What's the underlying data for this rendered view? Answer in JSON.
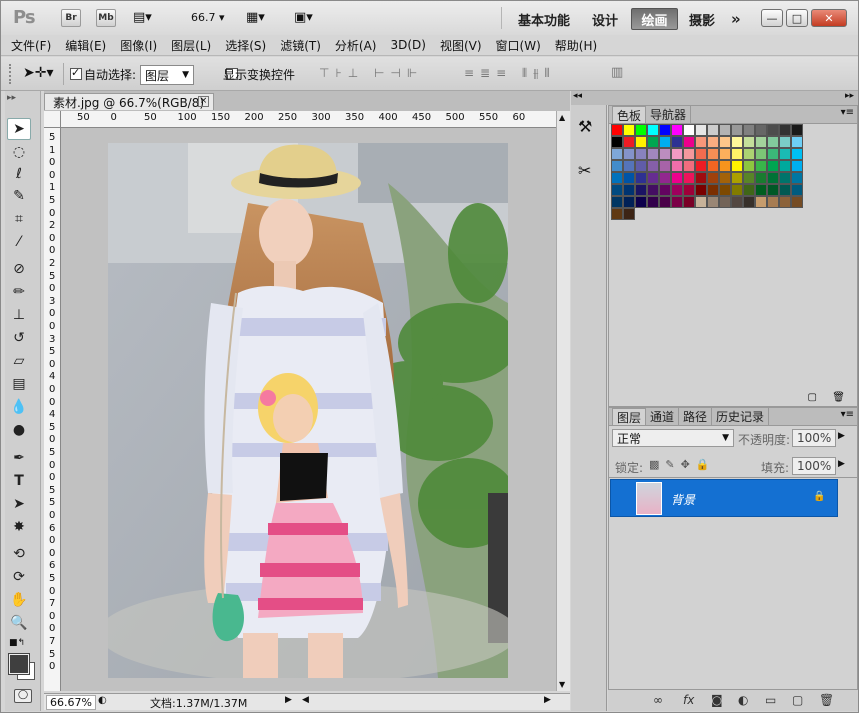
{
  "app": {
    "logo": "Ps",
    "bridge": "Br",
    "minibridge": "Mb",
    "zoom_value": "66.7"
  },
  "workspaces": {
    "basic": "基本功能",
    "design": "设计",
    "painting": "绘画",
    "photography": "摄影",
    "more": "»"
  },
  "window_buttons": {
    "minimize": "—",
    "restore": "□",
    "close": "✕"
  },
  "menu": [
    "文件(F)",
    "编辑(E)",
    "图像(I)",
    "图层(L)",
    "选择(S)",
    "滤镜(T)",
    "分析(A)",
    "3D(D)",
    "视图(V)",
    "窗口(W)",
    "帮助(H)"
  ],
  "options": {
    "auto_select_label": "自动选择:",
    "auto_select_checked": true,
    "auto_select_value": "图层",
    "show_transform_label": "显示变换控件",
    "show_transform_checked": false
  },
  "document": {
    "tab_title": "素材.jpg @ 66.7%(RGB/8)",
    "close": "×",
    "zoom": "66.67%",
    "doc_info": "文档:1.37M/1.37M"
  },
  "ruler": {
    "h_ticks": [
      "50",
      "0",
      "50",
      "100",
      "150",
      "200",
      "250",
      "300",
      "350",
      "400",
      "450",
      "500",
      "550",
      "60"
    ],
    "v_ticks": [
      "5",
      "1",
      "0",
      "0",
      "1",
      "5",
      "0",
      "2",
      "0",
      "0",
      "2",
      "5",
      "0",
      "3",
      "0",
      "0",
      "3",
      "5",
      "0",
      "4",
      "0",
      "0",
      "4",
      "5",
      "0",
      "5",
      "0",
      "0",
      "5",
      "5",
      "0",
      "6",
      "0",
      "0",
      "6",
      "5",
      "0",
      "7",
      "0",
      "0",
      "7",
      "5",
      "0"
    ]
  },
  "panels": {
    "color_tabs": [
      "色板",
      "导航器"
    ],
    "layers_tabs": [
      "图层",
      "通道",
      "路径",
      "历史记录"
    ],
    "blend_mode": "正常",
    "opacity_label": "不透明度:",
    "opacity_value": "100%",
    "lock_label": "锁定:",
    "fill_label": "填充:",
    "fill_value": "100%",
    "layer_name": "背景"
  },
  "swatch_colors": [
    "#ff0000",
    "#ffff00",
    "#00ff00",
    "#00ffff",
    "#0000ff",
    "#ff00ff",
    "#ffffff",
    "#e6e6e6",
    "#cccccc",
    "#b3b3b3",
    "#999999",
    "#808080",
    "#666666",
    "#4d4d4d",
    "#333333",
    "#1a1a1a",
    "#000000",
    "#ee1c24",
    "#fff200",
    "#00a651",
    "#00aeef",
    "#2e3192",
    "#ec008c",
    "#f7977a",
    "#f9ad81",
    "#fdc68a",
    "#fff79a",
    "#c4df9b",
    "#a3d39c",
    "#82ca9d",
    "#7bcdc8",
    "#6ecff6",
    "#7ea7d8",
    "#8493ca",
    "#8882be",
    "#a187be",
    "#bc8dbf",
    "#f49ac2",
    "#f6989d",
    "#f26c4f",
    "#f68e55",
    "#fbaf5c",
    "#fff467",
    "#acd372",
    "#7cc576",
    "#3bb878",
    "#1abbb4",
    "#00bff3",
    "#438ccb",
    "#5574b9",
    "#605ca8",
    "#855fa8",
    "#a763a8",
    "#f06eaa",
    "#f16d7e",
    "#ed1c24",
    "#f26522",
    "#f7941d",
    "#fff200",
    "#8dc63f",
    "#39b54a",
    "#00a651",
    "#00a99d",
    "#00aeef",
    "#0072bc",
    "#0054a6",
    "#2e3192",
    "#662d91",
    "#92278f",
    "#ec008c",
    "#ed145b",
    "#9e0b0f",
    "#a0410d",
    "#a36209",
    "#aba000",
    "#598527",
    "#197b30",
    "#007236",
    "#00746b",
    "#0076a3",
    "#004a80",
    "#003471",
    "#1b1464",
    "#440e62",
    "#630460",
    "#9e005d",
    "#9e0039",
    "#790000",
    "#7b2e00",
    "#7d4900",
    "#827b00",
    "#406618",
    "#005e20",
    "#005826",
    "#005952",
    "#005b7f",
    "#003663",
    "#002157",
    "#0d004c",
    "#32004b",
    "#4b0049",
    "#7b0046",
    "#7a0026",
    "#c7b299",
    "#998675",
    "#736357",
    "#534741",
    "#37302a",
    "#c69c6d",
    "#a67c52",
    "#8c6239",
    "#754c24",
    "#603913",
    "#3c2415"
  ],
  "colors": {
    "accent": "#1470d2",
    "panel": "#d2d2d2"
  }
}
